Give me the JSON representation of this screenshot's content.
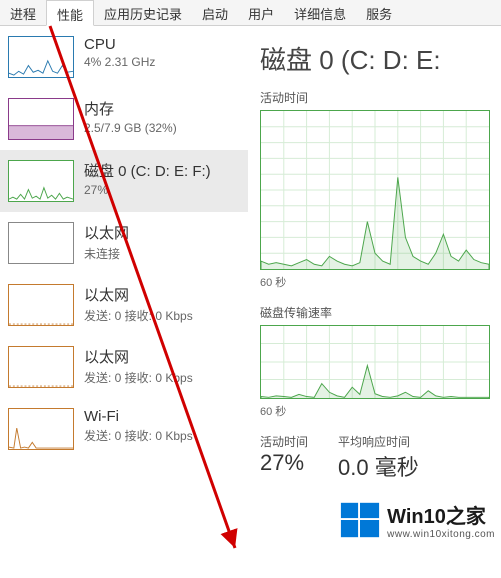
{
  "tabs": {
    "processes": "进程",
    "performance": "性能",
    "app_history": "应用历史记录",
    "startup": "启动",
    "users": "用户",
    "details": "详细信息",
    "services": "服务"
  },
  "sidebar": {
    "items": [
      {
        "title": "CPU",
        "sub": "4% 2.31 GHz",
        "color": "#2a7ab0"
      },
      {
        "title": "内存",
        "sub": "2.5/7.9 GB (32%)",
        "color": "#8a3a8a"
      },
      {
        "title": "磁盘 0 (C: D: E: F:)",
        "sub": "27%",
        "color": "#4ca64c"
      },
      {
        "title": "以太网",
        "sub": "未连接",
        "color": "#888"
      },
      {
        "title": "以太网",
        "sub": "发送: 0 接收: 0 Kbps",
        "color": "#c47a2e"
      },
      {
        "title": "以太网",
        "sub": "发送: 0 接收: 0 Kbps",
        "color": "#c47a2e"
      },
      {
        "title": "Wi-Fi",
        "sub": "发送: 0 接收: 0 Kbps",
        "color": "#c47a2e"
      }
    ]
  },
  "detail": {
    "title": "磁盘 0 (C: D: E:",
    "activity_label": "活动时间",
    "transfer_label": "磁盘传输速率",
    "axis_60s": "60 秒",
    "stats": {
      "activity_label": "活动时间",
      "avg_response_label": "平均响应时间",
      "activity_value": "27%",
      "avg_response_value": "0.0 毫秒"
    }
  },
  "watermark": {
    "title": "Win10之家",
    "sub": "www.win10xitong.com"
  },
  "chart_data": [
    {
      "type": "area",
      "title": "活动时间",
      "xlabel": "60 秒",
      "ylabel": "",
      "ylim": [
        0,
        100
      ],
      "series": [
        {
          "name": "活动时间 %",
          "values": [
            5,
            3,
            4,
            3,
            2,
            4,
            6,
            3,
            2,
            8,
            5,
            3,
            2,
            4,
            30,
            10,
            5,
            3,
            58,
            20,
            8,
            5,
            3,
            10,
            22,
            8,
            5,
            12,
            6,
            4,
            3
          ]
        }
      ]
    },
    {
      "type": "area",
      "title": "磁盘传输速率",
      "xlabel": "60 秒",
      "ylabel": "",
      "ylim": [
        0,
        100
      ],
      "series": [
        {
          "name": "传输速率",
          "values": [
            2,
            1,
            3,
            2,
            1,
            5,
            2,
            1,
            20,
            8,
            3,
            1,
            15,
            5,
            45,
            6,
            2,
            1,
            3,
            8,
            2,
            1,
            10,
            3,
            1,
            2,
            1,
            1,
            1,
            1,
            1
          ]
        }
      ]
    }
  ]
}
